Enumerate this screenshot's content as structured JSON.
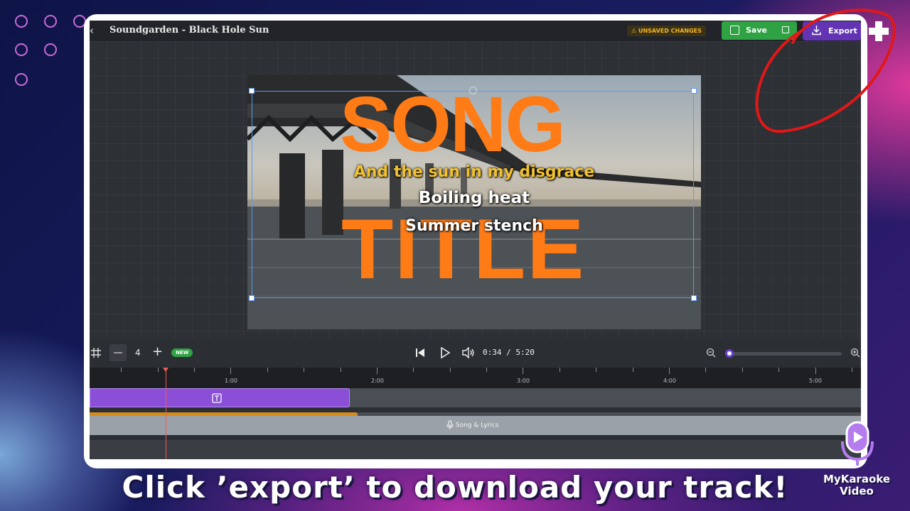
{
  "window": {
    "title": "Soundgarden - Black Hole Sun"
  },
  "header": {
    "unsaved_label": "UNSAVED CHANGES",
    "save_label": "Save",
    "export_label": "Export"
  },
  "preview": {
    "title_line1": "SONG",
    "title_line2": "TITLE",
    "lyrics": [
      "And the sun in my disgrace",
      "Boiling heat",
      "Summer stench"
    ]
  },
  "controls": {
    "zoom_value": "4",
    "new_badge": "NEW",
    "current_time": "0:34",
    "separator": "/",
    "total_time": "5:20"
  },
  "timeline": {
    "ruler_labels": [
      "1:00",
      "2:00",
      "3:00",
      "4:00",
      "5:00"
    ],
    "audio_track_label": "Song & Lyrics"
  },
  "caption": "Click ’export’ to download your track!",
  "brand": {
    "line1": "MyKaraoke",
    "line2": "Video"
  },
  "colors": {
    "accent_purple": "#6234b4",
    "save_green": "#2fa244",
    "title_orange": "#ff7b16",
    "annotation_red": "#e01818"
  }
}
